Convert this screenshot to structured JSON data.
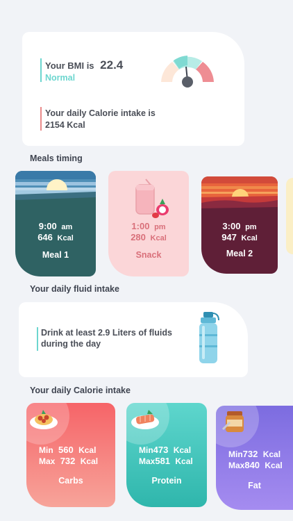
{
  "bmi": {
    "label": "Your BMI is",
    "value": "22.4",
    "status": "Normal",
    "calorie_line1": "Your daily Calorie intake is",
    "calorie_line2": "2154 Kcal"
  },
  "meals_timing": {
    "title": "Meals timing",
    "items": [
      {
        "time": "9:00",
        "ampm": "am",
        "kcal": "646",
        "unit": "Kcal",
        "name": "Meal 1"
      },
      {
        "time": "1:00",
        "ampm": "pm",
        "kcal": "280",
        "unit": "Kcal",
        "name": "Snack"
      },
      {
        "time": "3:00",
        "ampm": "pm",
        "kcal": "947",
        "unit": "Kcal",
        "name": "Meal 2"
      }
    ]
  },
  "fluid": {
    "title": "Your daily fluid intake",
    "line1": "Drink at least  2.9  Liters of fluids",
    "line2": "during the day"
  },
  "calorie_intake": {
    "title": "Your daily Calorie intake",
    "items": [
      {
        "min_label": "Min",
        "min": "560",
        "max_label": "Max",
        "max": "732",
        "unit": "Kcal",
        "name": "Carbs"
      },
      {
        "min_label": "Min",
        "min": "473",
        "max_label": "Max",
        "max": "581",
        "unit": "Kcal",
        "name": "Protein"
      },
      {
        "min_label": "Min",
        "min": "732",
        "max_label": "Max",
        "max": "840",
        "unit": "Kcal",
        "name": "Fat"
      }
    ]
  },
  "colors": {
    "accent_teal": "#6cd6cf",
    "accent_red": "#e98a8a",
    "meal1": "#2f6263",
    "snack": "#fbd6d8",
    "meal2": "#5f1f37",
    "carbs": "#f46f72",
    "protein": "#3fc9c0",
    "fat": "#8c7ae6"
  },
  "icons": [
    "bmi-gauge-icon",
    "smoothie-icon",
    "water-bottle-icon",
    "pasta-icon",
    "salmon-icon",
    "peanut-butter-icon"
  ]
}
